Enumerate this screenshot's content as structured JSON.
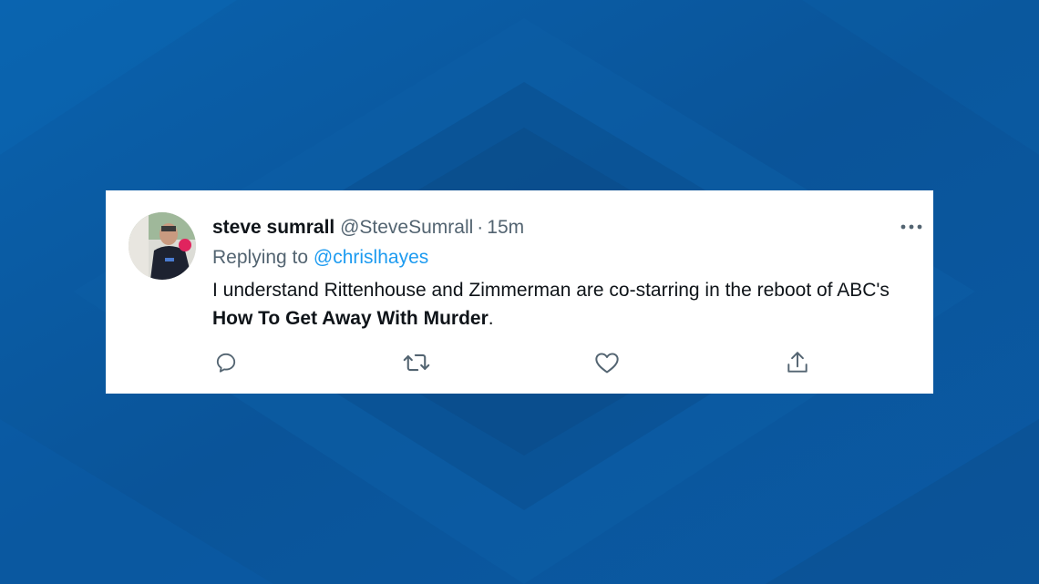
{
  "colors": {
    "background": "#0a5aa0",
    "card": "#ffffff",
    "text_primary": "#0f1419",
    "text_secondary": "#536471",
    "link": "#1d9bf0"
  },
  "tweet": {
    "author_name": "steve sumrall",
    "author_handle": "@SteveSumrall",
    "separator": "·",
    "timestamp": "15m",
    "replying_prefix": "Replying to",
    "replying_to": "@chrislhayes",
    "text_part1": "I understand Rittenhouse and Zimmerman are co-starring in the reboot of ABC's",
    "text_bold": "How To Get Away With Murder",
    "text_part2": ".",
    "avatar_icon": "profile-photo",
    "more_icon": "more-icon"
  },
  "actions": [
    {
      "name": "reply",
      "icon": "reply-icon"
    },
    {
      "name": "retweet",
      "icon": "retweet-icon"
    },
    {
      "name": "like",
      "icon": "like-icon"
    },
    {
      "name": "share",
      "icon": "share-icon"
    }
  ]
}
